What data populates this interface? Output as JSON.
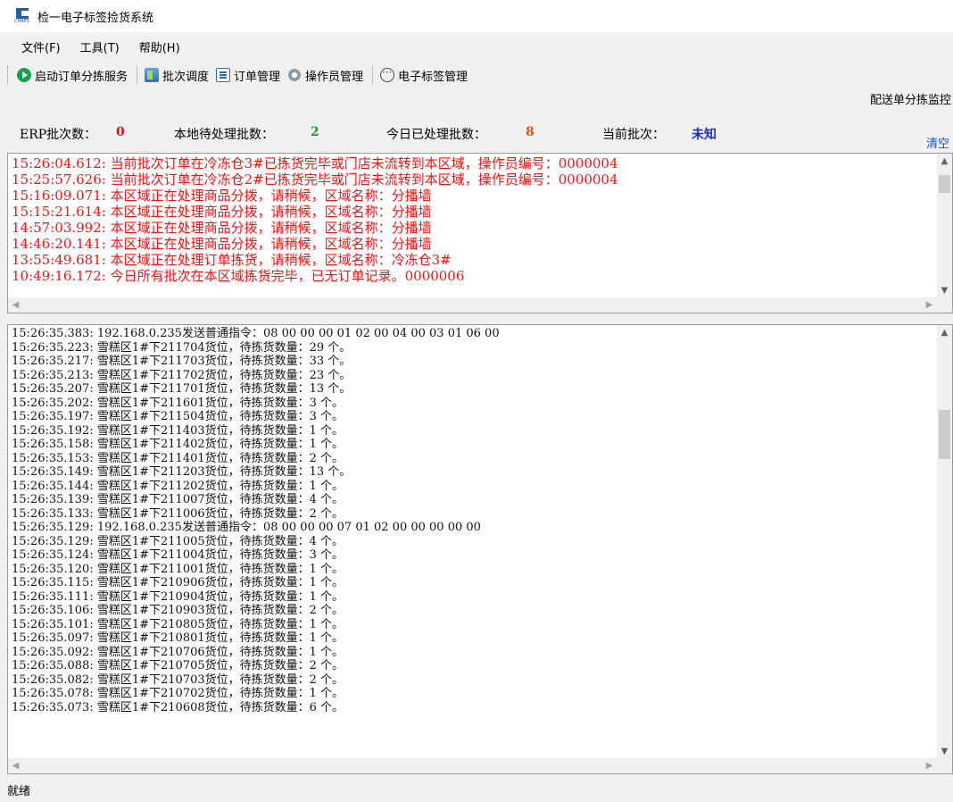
{
  "window": {
    "title": "检一电子标签捡货系统",
    "icon_text": "CHAPS"
  },
  "menu": [
    "文件(F)",
    "工具(T)",
    "帮助(H)"
  ],
  "toolbar": {
    "start_service": "启动订单分拣服务",
    "batch_dispatch": "批次调度",
    "order_mgmt": "订单管理",
    "operator_mgmt": "操作员管理",
    "tag_mgmt": "电子标签管理"
  },
  "panel_title": "配送单分拣监控",
  "stats": {
    "erp_label": "ERP批次数：",
    "erp_value": "0",
    "local_label": "本地待处理批数：",
    "local_value": "2",
    "today_label": "今日已处理批数：",
    "today_value": "8",
    "current_label": "当前批次：",
    "current_value": "未知",
    "clear": "清空"
  },
  "colors": {
    "erp": "#e01010",
    "local": "#1a9a1a",
    "today": "#d45a10",
    "current": "#1a2fd0",
    "alert": "#ff1010"
  },
  "alert_log": [
    "15:26:04.612: 当前批次订单在冷冻仓3#已拣货完毕或门店未流转到本区域，操作员编号：0000004",
    "15:25:57.626: 当前批次订单在冷冻仓2#已拣货完毕或门店未流转到本区域，操作员编号：0000004",
    "15:16:09.071: 本区域正在处理商品分拨，请稍候，区域名称：分播墙",
    "15:15:21.614: 本区域正在处理商品分拨，请稍候，区域名称：分播墙",
    "14:57:03.992: 本区域正在处理商品分拨，请稍候，区域名称：分播墙",
    "14:46:20.141: 本区域正在处理商品分拨，请稍候，区域名称：分播墙",
    "13:55:49.681: 本区域正在处理订单拣货，请稍候，区域名称：冷冻仓3#",
    "10:49:16.172: 今日所有批次在本区域拣货完毕，已无订单记录。0000006"
  ],
  "detail_log": [
    "15:26:35.383: 192.168.0.235发送普通指令：08 00 00 00 01 02 00 04 00 03 01 06 00",
    "15:26:35.223: 雪糕区1#下211704货位，待拣货数量：29 个。",
    "15:26:35.217: 雪糕区1#下211703货位，待拣货数量：33 个。",
    "15:26:35.213: 雪糕区1#下211702货位，待拣货数量：23 个。",
    "15:26:35.207: 雪糕区1#下211701货位，待拣货数量：13 个。",
    "15:26:35.202: 雪糕区1#下211601货位，待拣货数量：3 个。",
    "15:26:35.197: 雪糕区1#下211504货位，待拣货数量：3 个。",
    "15:26:35.192: 雪糕区1#下211403货位，待拣货数量：1 个。",
    "15:26:35.158: 雪糕区1#下211402货位，待拣货数量：1 个。",
    "15:26:35.153: 雪糕区1#下211401货位，待拣货数量：2 个。",
    "15:26:35.149: 雪糕区1#下211203货位，待拣货数量：13 个。",
    "15:26:35.144: 雪糕区1#下211202货位，待拣货数量：1 个。",
    "15:26:35.139: 雪糕区1#下211007货位，待拣货数量：4 个。",
    "15:26:35.133: 雪糕区1#下211006货位，待拣货数量：2 个。",
    "15:26:35.129: 192.168.0.235发送普通指令：08 00 00 00 07 01 02 00 00 00 00 00",
    "15:26:35.129: 雪糕区1#下211005货位，待拣货数量：4 个。",
    "15:26:35.124: 雪糕区1#下211004货位，待拣货数量：3 个。",
    "15:26:35.120: 雪糕区1#下211001货位，待拣货数量：1 个。",
    "15:26:35.115: 雪糕区1#下210906货位，待拣货数量：1 个。",
    "15:26:35.111: 雪糕区1#下210904货位，待拣货数量：1 个。",
    "15:26:35.106: 雪糕区1#下210903货位，待拣货数量：2 个。",
    "15:26:35.101: 雪糕区1#下210805货位，待拣货数量：1 个。",
    "15:26:35.097: 雪糕区1#下210801货位，待拣货数量：1 个。",
    "15:26:35.092: 雪糕区1#下210706货位，待拣货数量：1 个。",
    "15:26:35.088: 雪糕区1#下210705货位，待拣货数量：2 个。",
    "15:26:35.082: 雪糕区1#下210703货位，待拣货数量：2 个。",
    "15:26:35.078: 雪糕区1#下210702货位，待拣货数量：1 个。",
    "15:26:35.073: 雪糕区1#下210608货位，待拣货数量：6 个。"
  ],
  "status": "就绪"
}
